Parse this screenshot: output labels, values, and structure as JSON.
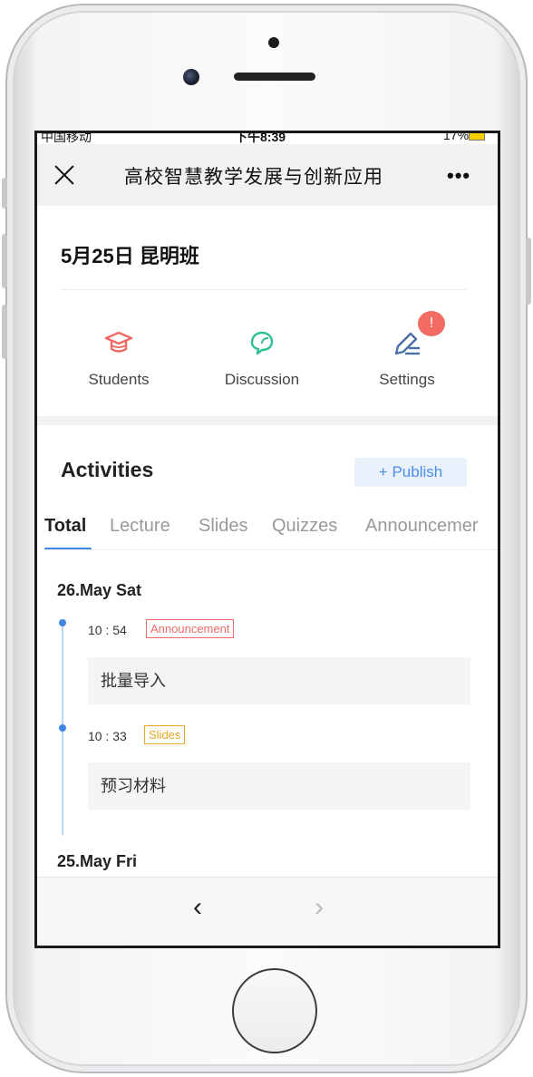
{
  "status_bar": {
    "carrier": "中国移动",
    "time": "下午8:39",
    "battery": "17%"
  },
  "nav": {
    "title": "高校智慧教学发展与创新应用",
    "more": "•••"
  },
  "class_title": "5月25日 昆明班",
  "tools": [
    {
      "label": "Students",
      "icon": "graduation-cap-icon",
      "color": "#ef6b66"
    },
    {
      "label": "Discussion",
      "icon": "chat-bubbles-icon",
      "color": "#2dbd94"
    },
    {
      "label": "Settings",
      "icon": "edit-pen-icon",
      "color": "#4a6ea8",
      "badge": "!"
    }
  ],
  "activities": {
    "title": "Activities",
    "publish_label": "Publish",
    "tabs": [
      "Total",
      "Lecture",
      "Slides",
      "Quizzes",
      "Announcemer"
    ],
    "active_tab": "Total"
  },
  "timeline": [
    {
      "date": "26.May   Sat",
      "items": [
        {
          "time": "10 : 54",
          "tag": "Announcement",
          "title": "批量导入"
        },
        {
          "time": "10 : 33",
          "tag": "Slides",
          "title": "预习材料"
        }
      ]
    },
    {
      "date": "25.May   Fri",
      "items": []
    }
  ],
  "bottom_nav": {
    "back": "‹",
    "forward": "›"
  },
  "colors": {
    "accent_blue": "#3f86e6",
    "announcement_red": "#ef6b66",
    "slides_orange": "#e8a726"
  }
}
